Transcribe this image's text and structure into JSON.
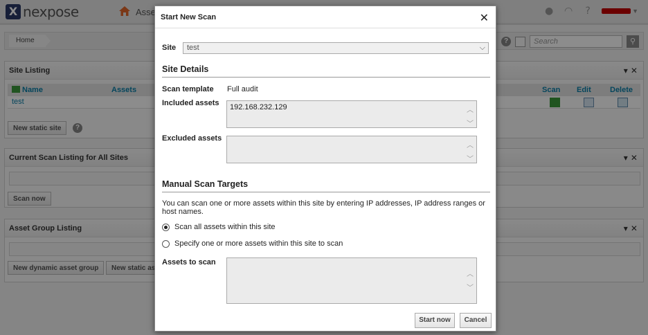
{
  "app": {
    "logo_text": "nexpose",
    "logo_mark": "X",
    "nav_assets_label": "Asse",
    "breadcrumb_home": "Home",
    "search_placeholder": "Search"
  },
  "site_listing": {
    "title": "Site Listing",
    "columns": [
      "Name",
      "Assets",
      "Scan",
      "Edit",
      "Delete"
    ],
    "rows": [
      {
        "name": "test"
      }
    ],
    "new_static_site_label": "New static site"
  },
  "scan_listing": {
    "title": "Current Scan Listing for All Sites",
    "scan_now_label": "Scan now"
  },
  "asset_group_listing": {
    "title": "Asset Group Listing",
    "new_dynamic_label": "New dynamic asset group",
    "new_static_label": "New static as"
  },
  "modal": {
    "title": "Start New Scan",
    "close_glyph": "✕",
    "site_label": "Site",
    "site_value": "test",
    "site_details_title": "Site Details",
    "scan_template_label": "Scan template",
    "scan_template_value": "Full audit",
    "included_assets_label": "Included assets",
    "included_assets_value": "192.168.232.129",
    "excluded_assets_label": "Excluded assets",
    "excluded_assets_value": "",
    "manual_targets_title": "Manual Scan Targets",
    "manual_targets_desc": "You can scan one or more assets within this site by entering IP addresses, IP address ranges or host names.",
    "radio_all_label": "Scan all assets within this site",
    "radio_specify_label": "Specify one or more assets within this site to scan",
    "selected_option": "Scan all assets within this site",
    "assets_to_scan_label": "Assets to scan",
    "assets_to_scan_value": "",
    "start_now_label": "Start now",
    "cancel_label": "Cancel"
  },
  "colors": {
    "accent": "#0a7fa8",
    "brand_red": "#c40000",
    "logo_blue": "#2b3a67",
    "home_orange": "#e0662a"
  },
  "icons": {
    "home": "home-icon",
    "chat": "chat-icon",
    "dashboard": "gauge-icon",
    "help": "question-icon",
    "search": "search-icon",
    "filter": "filter-icon",
    "close": "close-icon",
    "scan": "scan-play-icon",
    "edit": "edit-icon",
    "delete": "trash-icon"
  }
}
